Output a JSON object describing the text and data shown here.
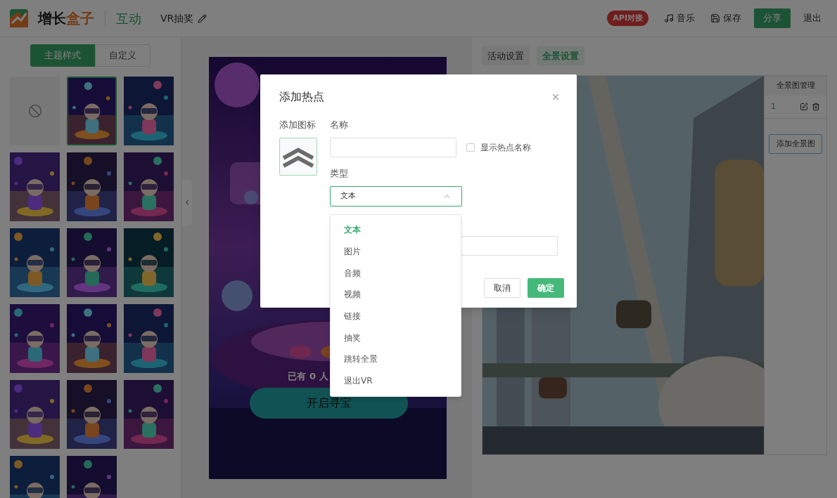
{
  "header": {
    "logo_text_1": "增长",
    "logo_text_2": "盒子",
    "section": "互动",
    "title": "VR抽奖",
    "api_badge": "API对接",
    "actions": [
      {
        "kind": "music",
        "label": "音乐"
      },
      {
        "kind": "save",
        "label": "保存"
      }
    ],
    "share": "分享",
    "exit": "退出"
  },
  "left_panel": {
    "tabs": [
      {
        "label": "主题样式",
        "selected": true
      },
      {
        "label": "自定义",
        "selected": false
      }
    ],
    "themes": [
      {
        "kind": "none",
        "selected": false
      },
      {
        "kind": "picture",
        "selected": true
      },
      {
        "kind": "picture",
        "selected": false
      },
      {
        "kind": "picture",
        "selected": false
      },
      {
        "kind": "picture",
        "selected": false
      },
      {
        "kind": "picture",
        "selected": false
      },
      {
        "kind": "picture",
        "selected": false
      },
      {
        "kind": "picture",
        "selected": false
      },
      {
        "kind": "picture",
        "selected": false
      },
      {
        "kind": "picture",
        "selected": false
      },
      {
        "kind": "picture",
        "selected": false
      },
      {
        "kind": "picture",
        "selected": false
      },
      {
        "kind": "picture",
        "selected": false
      },
      {
        "kind": "picture",
        "selected": false
      },
      {
        "kind": "picture",
        "selected": false
      },
      {
        "kind": "picture",
        "selected": false
      },
      {
        "kind": "picture",
        "selected": false
      }
    ]
  },
  "preview": {
    "participants": "已有 0 人",
    "button": "开启寻宝"
  },
  "right_panel": {
    "tabs": [
      {
        "label": "活动设置",
        "selected": false
      },
      {
        "label": "全景设置",
        "selected": true
      }
    ],
    "manager": {
      "title": "全景图管理",
      "items": [
        {
          "label": "1"
        }
      ],
      "add_button": "添加全景图"
    }
  },
  "dialog": {
    "title": "添加热点",
    "icon_label": "添加图标",
    "name_label": "名称",
    "show_name": {
      "label": "显示热点名称",
      "checked": false
    },
    "type_label": "类型",
    "type_value": "文本",
    "type_open": true,
    "options": [
      {
        "label": "文本",
        "selected": true
      },
      {
        "label": "图片",
        "selected": false
      },
      {
        "label": "音频",
        "selected": false
      },
      {
        "label": "视频",
        "selected": false
      },
      {
        "label": "链接",
        "selected": false
      },
      {
        "label": "抽奖",
        "selected": false
      },
      {
        "label": "跳转全景",
        "selected": false
      },
      {
        "label": "退出VR",
        "selected": false
      }
    ],
    "cancel": "取消",
    "confirm": "确定"
  }
}
